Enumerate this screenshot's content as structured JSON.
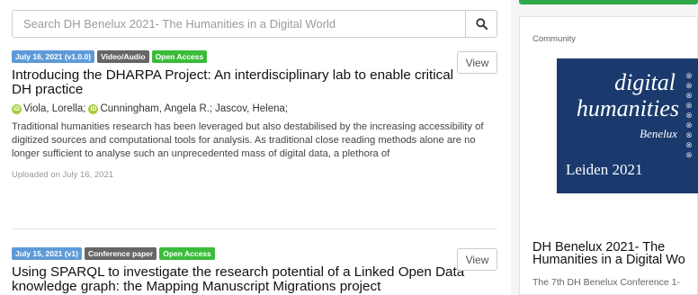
{
  "search": {
    "placeholder": "Search DH Benelux 2021- The Humanities in a Digital World"
  },
  "records": [
    {
      "date_label": "July 16, 2021 (v1.0.0)",
      "type_label": "Video/Audio",
      "access_label": "Open Access",
      "view_label": "View",
      "title": "Introducing the DHARPA Project: An interdisciplinary lab to enable critical DH practice",
      "authors": [
        "Viola, Lorella;",
        "Cunningham, Angela R.;",
        "Jascov, Helena;"
      ],
      "description": "Traditional humanities research has been leveraged but also destabilised by the increasing accessibility of digitized sources and computational tools for analysis. As traditional close reading methods alone are no longer sufficient to analyse such an unprecedented mass of digital data, a plethora of",
      "uploaded": "Uploaded on July 16, 2021"
    },
    {
      "date_label": "July 15, 2021 (v1)",
      "type_label": "Conference paper",
      "access_label": "Open Access",
      "view_label": "View",
      "title": "Using SPARQL to investigate the research potential of a Linked Open Data knowledge graph: the Mapping Manuscript Migrations project"
    }
  ],
  "community": {
    "label": "Community",
    "logo_line1": "digital",
    "logo_line2": "humanities",
    "logo_line3": "Benelux",
    "logo_line4": "Leiden 2021",
    "title_line1": "DH Benelux 2021- The",
    "title_line2": "Humanities in a Digital Wo",
    "description": "The 7th DH Benelux Conference 1-",
    "accent_color": "#2ea84a",
    "logo_bg_color": "#1a3a6e"
  },
  "colors": {
    "date_badge": "#5d9bd8",
    "type_badge": "#666666",
    "open_access_badge": "#3bbc3b",
    "orcid": "#a6ce39"
  },
  "icons": {
    "search": "search-icon",
    "orcid": "orcid-icon"
  }
}
